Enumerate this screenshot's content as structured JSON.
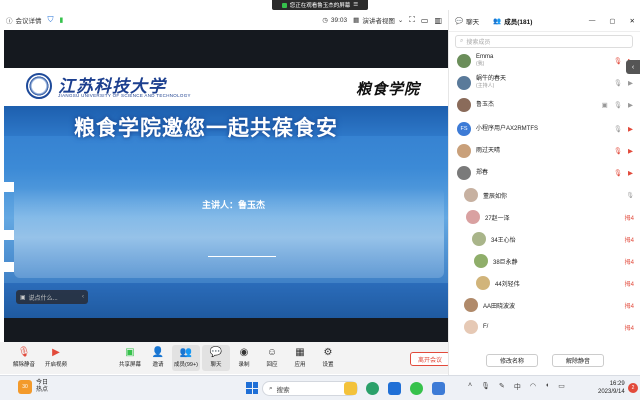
{
  "banner": {
    "text": "您正在观看鲁玉杰的屏幕"
  },
  "topbar": {
    "meeting_info": "会议详情",
    "timer": "39:03",
    "view_mode": "演讲者视图"
  },
  "slide": {
    "university_cn": "江苏科技大学",
    "university_en": "JIANGSU UNIVERSITY OF SCIENCE AND TECHNOLOGY",
    "college": "粮食学院",
    "headline": "粮食学院邀您一起共葆食安",
    "speaker": "主讲人：鲁玉杰"
  },
  "chat_input": {
    "placeholder": "说点什么..."
  },
  "toolbar": {
    "items": [
      {
        "label": "解除静音",
        "icon": "mic-muted-icon"
      },
      {
        "label": "开启视频",
        "icon": "camera-off-icon"
      },
      {
        "label": "共享屏幕",
        "icon": "share-screen-icon"
      },
      {
        "label": "邀请",
        "icon": "invite-icon"
      },
      {
        "label": "成员(99+)",
        "icon": "members-icon"
      },
      {
        "label": "聊天",
        "icon": "chat-icon"
      },
      {
        "label": "录制",
        "icon": "record-icon"
      },
      {
        "label": "回应",
        "icon": "reaction-icon"
      },
      {
        "label": "应用",
        "icon": "apps-icon"
      },
      {
        "label": "设置",
        "icon": "settings-icon"
      }
    ],
    "leave": "离开会议"
  },
  "panel": {
    "tab_chat": "聊天",
    "tab_members": "成员(181)",
    "search_placeholder": "搜索成员",
    "members": [
      {
        "name": "Emma",
        "sub": "(我)",
        "avatar": "",
        "color": "#6b8e5a"
      },
      {
        "name": "蜗牛的春天",
        "sub": "(主持人)",
        "avatar": "",
        "color": "#5a7a9a"
      },
      {
        "name": "鲁玉杰",
        "sub": "",
        "avatar": "",
        "color": "#8a6b5a"
      },
      {
        "name": "小程序用户AX2RMTFS",
        "sub": "",
        "avatar": "FS",
        "color": "#3d7bd6"
      },
      {
        "name": "雨过天晴",
        "sub": "",
        "avatar": "",
        "color": "#c9a07a"
      },
      {
        "name": "郑春",
        "sub": "",
        "avatar": "",
        "color": "#7a7a7a"
      }
    ],
    "ghost_members": [
      {
        "name": "董辰如你"
      },
      {
        "name": "27赵一泽"
      },
      {
        "name": "34王心怡"
      },
      {
        "name": "38巨永静"
      },
      {
        "name": "44刘轻伟"
      },
      {
        "name": "AA田晓波波"
      },
      {
        "name": "F/"
      }
    ],
    "ghost_badges": [
      "拇4",
      "拇4",
      "拇4",
      "拇4",
      "拇4",
      "拇4"
    ],
    "rename_button": "修改名称",
    "unmute_button": "解除静音"
  },
  "taskbar": {
    "weather_temp": "30",
    "weather_day": "今日",
    "weather_desc": "热点",
    "search": "搜索",
    "time": "16:29",
    "date": "2023/9/14",
    "notifications": "2"
  }
}
